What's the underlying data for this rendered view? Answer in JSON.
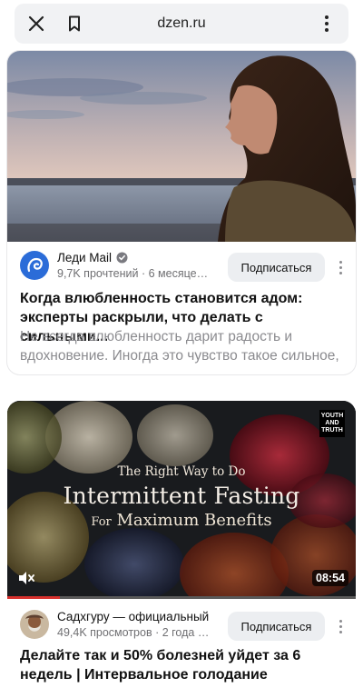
{
  "browser": {
    "url": "dzen.ru",
    "icons": {
      "close": "close-icon",
      "bookmark": "bookmark-icon",
      "menu": "more-vertical-icon"
    }
  },
  "cards": [
    {
      "channel": "Леди Mail",
      "verified": true,
      "stats": "9,7K прочтений · 6 месяцев н...",
      "subscribe_label": "Подписаться",
      "title": "Когда влюбленность становится адом: эксперты раскрыли, что делать с сильными...",
      "description_lines": [
        "Не всегда влюбленность дарит радость и",
        "вдохновение. Иногда это чувство такое сильное,"
      ]
    },
    {
      "channel": "Садхгуру — официальный ка...",
      "stats": "49,4K просмотров · 2 года на...",
      "subscribe_label": "Подписаться",
      "title": "Делайте так и 50% болезней уйдет за 6 недель | Интервальное голодание",
      "video": {
        "overlay_line1": "The Right Way to Do",
        "overlay_line2": "Intermittent Fasting",
        "overlay_line3_prefix": "For",
        "overlay_line3_main": "Maximum Benefits",
        "logo_text": "YOUTH AND TRUTH",
        "duration": "08:54",
        "progress": 0.15
      }
    }
  ],
  "colors": {
    "progress": "#d8312e",
    "subscribe_bg": "#eceef1",
    "muted_text": "#8b8b8f"
  }
}
